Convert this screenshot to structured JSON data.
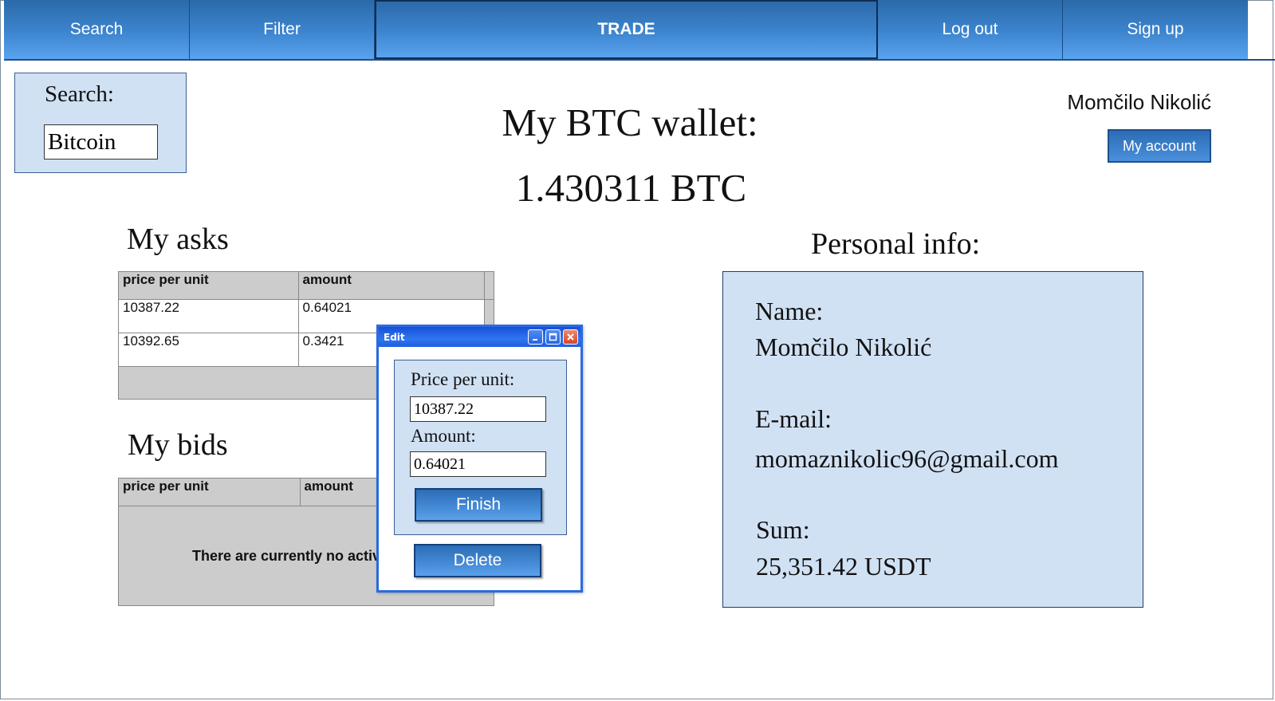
{
  "nav": {
    "items": [
      {
        "label": "Search"
      },
      {
        "label": "Filter"
      },
      {
        "label": "TRADE"
      },
      {
        "label": "Log out"
      },
      {
        "label": "Sign up"
      }
    ]
  },
  "search": {
    "label": "Search:",
    "value": "Bitcoin"
  },
  "wallet": {
    "title": "My BTC wallet:",
    "amount": "1.430311 BTC"
  },
  "user": {
    "name": "Momčilo Nikolić",
    "account_button": "My account"
  },
  "asks": {
    "title": "My asks",
    "columns": [
      "price per unit",
      "amount"
    ],
    "rows": [
      [
        "10387.22",
        "0.64021"
      ],
      [
        "10392.65",
        "0.3421"
      ]
    ]
  },
  "bids": {
    "title": "My bids",
    "columns": [
      "price per unit",
      "amount"
    ],
    "empty_message": "There are currently no activ"
  },
  "personal": {
    "title": "Personal info:",
    "name_label": "Name:",
    "name_value": "Momčilo Nikolić",
    "email_label": "E-mail:",
    "email_value": "momaznikolic96@gmail.com",
    "sum_label": "Sum:",
    "sum_value": "25,351.42 USDT"
  },
  "edit_dialog": {
    "title": "Edit",
    "price_label": "Price per unit:",
    "price_value": "10387.22",
    "amount_label": "Amount:",
    "amount_value": "0.64021",
    "finish_label": "Finish",
    "delete_label": "Delete"
  }
}
